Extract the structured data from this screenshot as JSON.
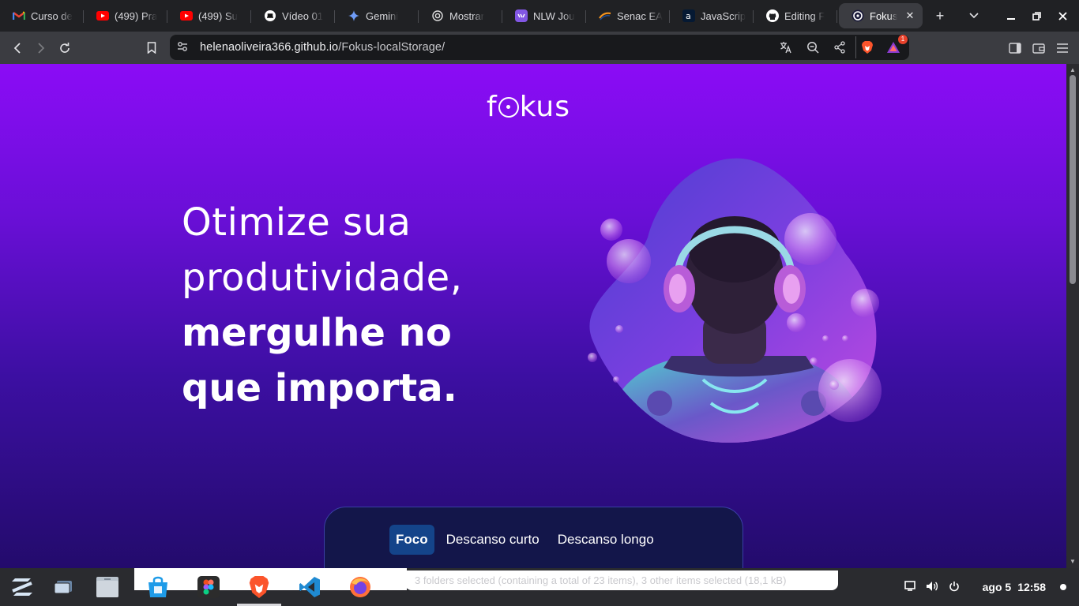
{
  "browser": {
    "tabs": [
      {
        "title": "Curso de",
        "icon": "gmail-icon"
      },
      {
        "title": "(499) Pra",
        "icon": "youtube-icon"
      },
      {
        "title": "(499) Su",
        "icon": "youtube-icon"
      },
      {
        "title": "Vídeo 01",
        "icon": "hat-icon"
      },
      {
        "title": "Gemini",
        "icon": "gemini-icon"
      },
      {
        "title": "Mostrar",
        "icon": "openai-icon"
      },
      {
        "title": "NLW Jou",
        "icon": "rocketseat-icon"
      },
      {
        "title": "Senac EA",
        "icon": "senac-icon"
      },
      {
        "title": "JavaScrip",
        "icon": "alura-icon"
      },
      {
        "title": "Editing F",
        "icon": "github-icon"
      },
      {
        "title": "Fokus",
        "icon": "fokus-icon",
        "active": true
      }
    ],
    "url_host": "helenaoliveira366.github.io",
    "url_path": "/Fokus-localStorage/",
    "notification_count": "1"
  },
  "page": {
    "logo": "fokus",
    "headline_line1": "Otimize sua",
    "headline_line2": "produtividade,",
    "headline_line3": "mergulhe no",
    "headline_line4": "que importa.",
    "modes": [
      "Foco",
      "Descanso curto",
      "Descanso longo"
    ],
    "active_mode": "Foco"
  },
  "taskbar": {
    "status_text": "3 folders selected (containing a total of 23 items), 3 other items selected (18,1 kB)",
    "date": "ago 5",
    "time": "12:58"
  },
  "colors": {
    "page_top": "#8b0cf6",
    "page_bottom": "#230b6c",
    "card_bg": "#13164a",
    "active_mode_bg": "#14448a"
  }
}
